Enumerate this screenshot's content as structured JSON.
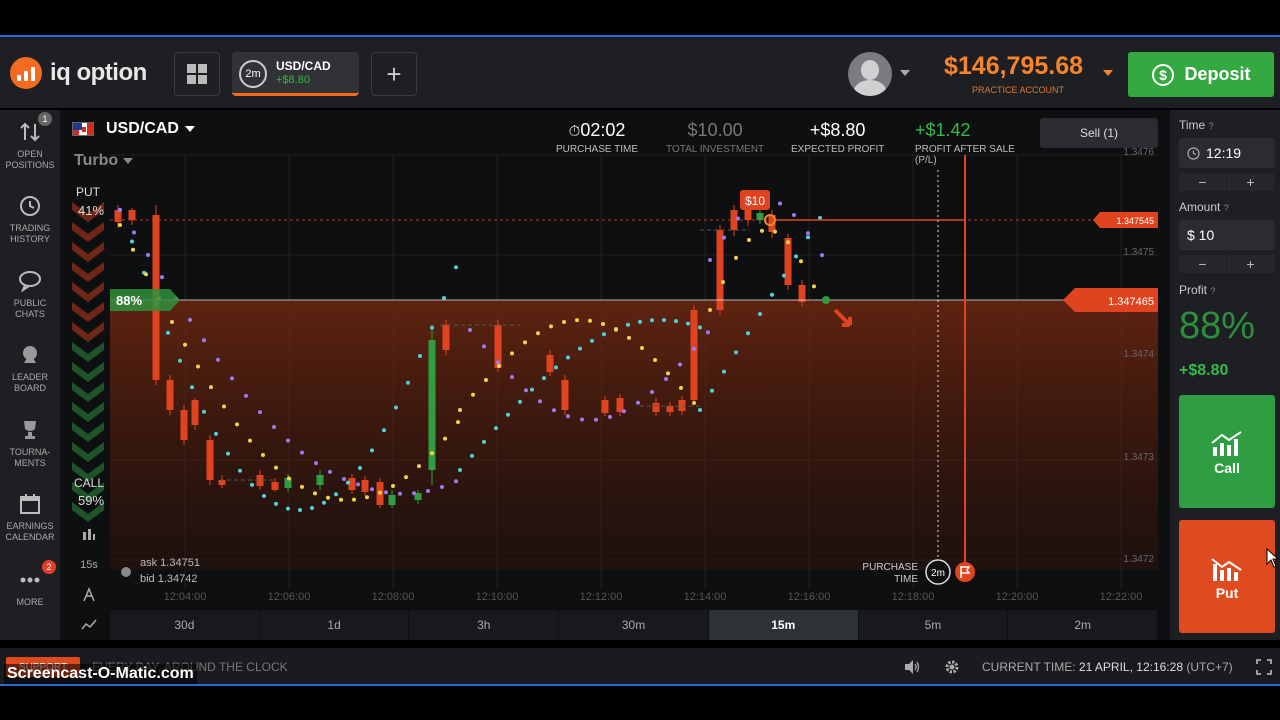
{
  "header": {
    "logo_text": "iq option",
    "active_asset_tab": {
      "period": "2m",
      "name": "USD/CAD",
      "profit": "+$8.80"
    },
    "add_tab_label": "+",
    "balance": "$146,795.68",
    "account_type": "PRACTICE ACCOUNT",
    "deposit_label": "Deposit"
  },
  "sidebar": {
    "items": [
      {
        "icon": "open-positions-icon",
        "label1": "OPEN",
        "label2": "POSITIONS",
        "badge": "1"
      },
      {
        "icon": "history-icon",
        "label1": "TRADING",
        "label2": "HISTORY"
      },
      {
        "icon": "chat-icon",
        "label1": "PUBLIC",
        "label2": "CHATS"
      },
      {
        "icon": "leaderboard-icon",
        "label1": "LEADER",
        "label2": "BOARD"
      },
      {
        "icon": "trophy-icon",
        "label1": "TOURNA-",
        "label2": "MENTS"
      },
      {
        "icon": "calendar-icon",
        "label1": "EARNINGS",
        "label2": "CALENDAR"
      },
      {
        "icon": "more-icon",
        "label1": "MORE",
        "label2": "",
        "badge": "2"
      }
    ]
  },
  "chart": {
    "asset": "USD/CAD",
    "mode": "Turbo",
    "put_label": "PUT",
    "put_pct": "41%",
    "call_label": "CALL",
    "call_pct": "59%",
    "purchase_time": {
      "value": "02:02",
      "label": "PURCHASE TIME"
    },
    "total_investment": {
      "value": "$10.00",
      "label": "TOTAL INVESTMENT"
    },
    "expected_profit": {
      "value": "+$8.80",
      "label": "EXPECTED PROFIT"
    },
    "profit_after_sale": {
      "value": "+$1.42",
      "label1": "PROFIT AFTER SALE",
      "label2": "(P/L)"
    },
    "sell_label": "Sell (1)",
    "current_price_tag": "1.347465",
    "entry_price_tag": "1.347545",
    "entry_amount_tag": "$10",
    "profit_tag": "88%",
    "y_ticks": [
      "1.3476",
      "1.3475",
      "1.3474",
      "1.3473",
      "1.3472"
    ],
    "x_ticks": [
      "12:04:00",
      "12:06:00",
      "12:08:00",
      "12:10:00",
      "12:12:00",
      "12:14:00",
      "12:16:00",
      "12:18:00",
      "12:20:00",
      "12:22:00"
    ],
    "ask": "ask 1.34751",
    "bid": "bid 1.34742",
    "purchase_marker_label1": "PURCHASE",
    "purchase_marker_label2": "TIME",
    "purchase_marker_period": "2m",
    "candle_size": "15s",
    "timeframes": [
      "30d",
      "1d",
      "3h",
      "30m",
      "15m",
      "5m",
      "2m"
    ],
    "active_timeframe": "15m"
  },
  "right_panel": {
    "time_label": "Time",
    "time_value": "12:19",
    "amount_label": "Amount",
    "amount_value": "$ 10",
    "profit_label": "Profit",
    "profit_pct": "88%",
    "profit_amount": "+$8.80",
    "call_label": "Call",
    "put_label": "Put",
    "minus": "−",
    "plus": "+"
  },
  "footer": {
    "support_label": "SUPPORT",
    "tagline": "EVERY DAY, AROUND THE CLOCK",
    "current_time_label": "CURRENT TIME:",
    "current_time_value": "21 APRIL, 12:16:28",
    "timezone": "(UTC+7)"
  },
  "watermark": "Screencast-O-Matic.com",
  "colors": {
    "accent_orange": "#f36b21",
    "deposit_green": "#34a941",
    "call_green": "#2f9e43",
    "put_red": "#e04a1f",
    "bull_candle": "#2f9e43",
    "bear_candle": "#e0431f"
  }
}
